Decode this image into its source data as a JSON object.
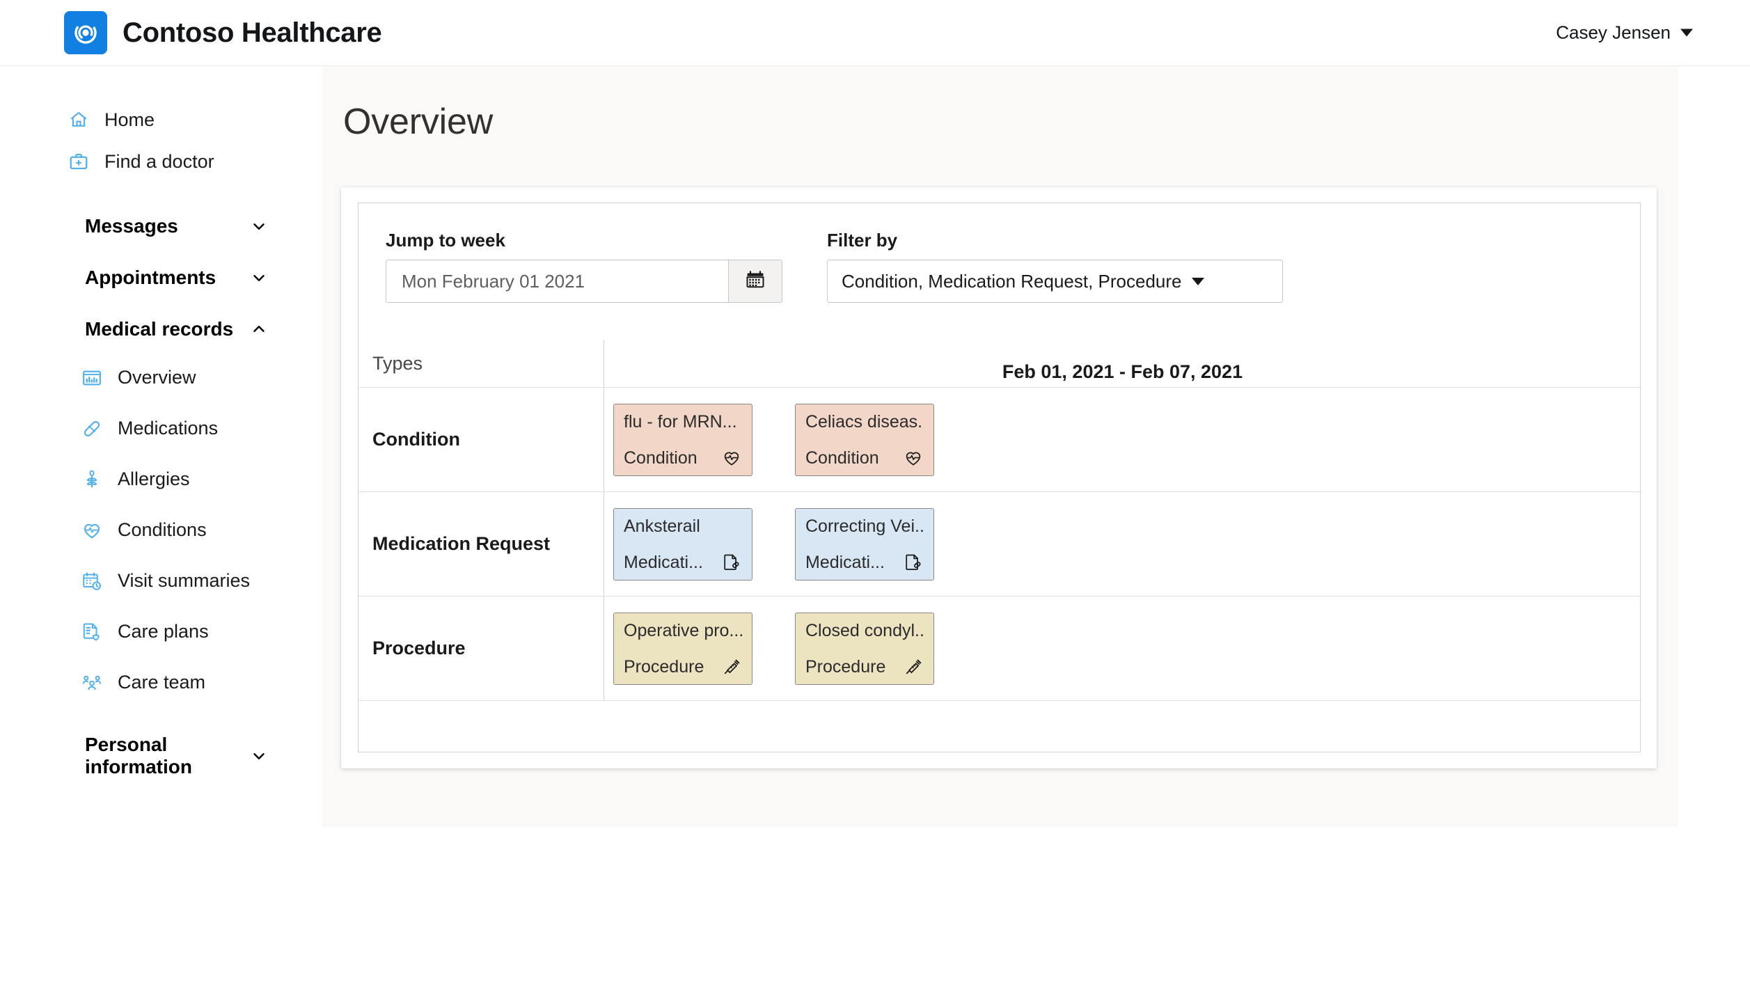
{
  "app": {
    "brand": "Contoso Healthcare",
    "logo_icon": "contoso-swirl-logo",
    "logo_color": "#1280e0",
    "user": "Casey Jensen"
  },
  "sidebar": {
    "links": [
      {
        "label": "Home",
        "icon": "home-icon"
      },
      {
        "label": "Find a doctor",
        "icon": "doctor-bag-icon"
      }
    ],
    "sections": [
      {
        "label": "Messages",
        "icon": "chevron-down-icon",
        "expanded": false
      },
      {
        "label": "Appointments",
        "icon": "chevron-down-icon",
        "expanded": false
      },
      {
        "label": "Medical records",
        "icon": "chevron-up-icon",
        "expanded": true
      },
      {
        "label": "Personal information",
        "icon": "chevron-down-icon",
        "expanded": false
      }
    ],
    "medical_records_items": [
      {
        "label": "Overview",
        "icon": "chart-window-icon"
      },
      {
        "label": "Medications",
        "icon": "pill-icon"
      },
      {
        "label": "Allergies",
        "icon": "plant-allergen-icon"
      },
      {
        "label": "Conditions",
        "icon": "heart-pulse-icon"
      },
      {
        "label": "Visit summaries",
        "icon": "calendar-clock-icon"
      },
      {
        "label": "Care plans",
        "icon": "document-heart-icon"
      },
      {
        "label": "Care team",
        "icon": "people-team-icon"
      }
    ]
  },
  "page": {
    "title": "Overview"
  },
  "controls": {
    "jump_label": "Jump to week",
    "jump_value": "Mon February 01 2021",
    "jump_placeholder": "Mon February 01 2021",
    "calendar_icon": "calendar-icon",
    "filter_label": "Filter by",
    "filter_value": "Condition, Medication Request, Procedure",
    "filter_icon": "chevron-down-icon"
  },
  "timeline": {
    "types_header": "Types",
    "date_range": "Feb 01, 2021 - Feb 07, 2021",
    "colors": {
      "condition": "#f2d6c8",
      "medication": "#d9e7f5",
      "procedure": "#ece3c0",
      "card_border": "#8a8886"
    },
    "rows": [
      {
        "type": "Condition",
        "cards": [
          {
            "title": "flu - for MRN...",
            "type": "Condition",
            "icon": "heart-pulse-icon",
            "color_key": "condition"
          },
          {
            "title": "Celiacs diseas...",
            "type": "Condition",
            "icon": "heart-pulse-icon",
            "color_key": "condition"
          }
        ]
      },
      {
        "type": "Medication Request",
        "cards": [
          {
            "title": "Anksterail",
            "type": "Medicati...",
            "icon": "prescription-doc-icon",
            "color_key": "medication"
          },
          {
            "title": "Correcting Vei...",
            "type": "Medicati...",
            "icon": "prescription-doc-icon",
            "color_key": "medication"
          }
        ]
      },
      {
        "type": "Procedure",
        "cards": [
          {
            "title": "Operative pro...",
            "type": "Procedure",
            "icon": "syringe-icon",
            "color_key": "procedure"
          },
          {
            "title": "Closed condyl...",
            "type": "Procedure",
            "icon": "syringe-icon",
            "color_key": "procedure"
          }
        ]
      }
    ]
  }
}
